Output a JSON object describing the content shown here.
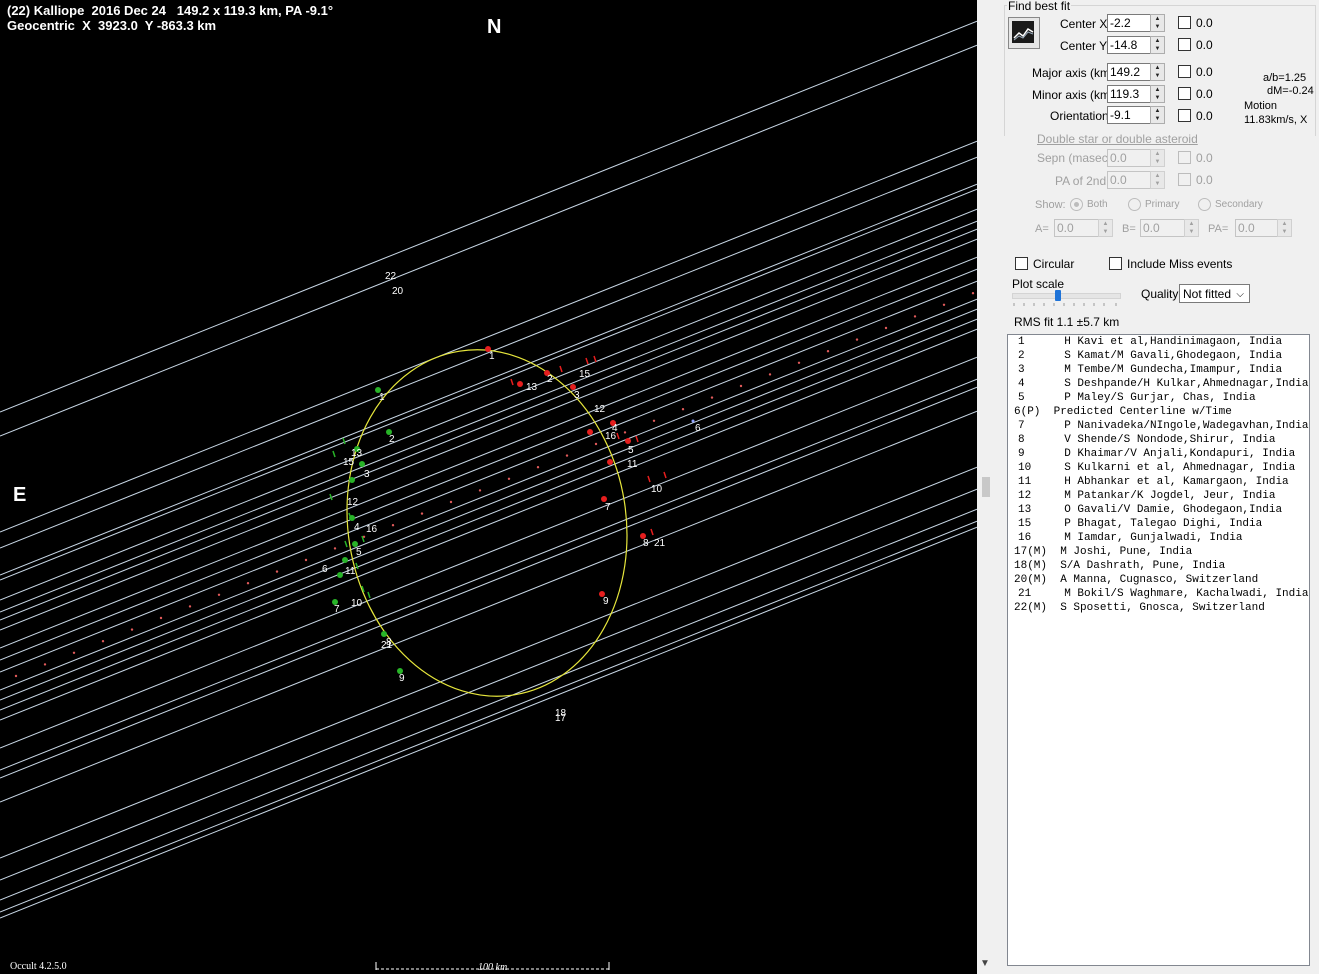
{
  "plot": {
    "title_line1": "(22) Kalliope  2016 Dec 24   149.2 x 119.3 km, PA -9.1°",
    "title_line2": "Geocentric  X  3923.0  Y -863.3 km",
    "north_label": "N",
    "east_label": "E",
    "version": "Occult 4.2.5.0",
    "scale_label": "100 km",
    "colors": {
      "background": "#000000",
      "chord": "#c8d7e6",
      "ellipse": "#e6e63c",
      "disappear": "#28b428",
      "reappear": "#e61e1e",
      "predicted": "#e05a5a"
    },
    "markers": {
      "d_labels": [
        "1",
        "2",
        "13",
        "15",
        "3",
        "12",
        "4",
        "16",
        "5",
        "6",
        "11",
        "7",
        "10",
        "8",
        "21",
        "9"
      ],
      "r_labels": [
        "1",
        "13",
        "2",
        "15",
        "3",
        "12",
        "4",
        "16",
        "5",
        "11",
        "10",
        "7",
        "8",
        "21",
        "9"
      ],
      "miss_labels": [
        "22",
        "20",
        "18",
        "17"
      ],
      "predicted_label": "6"
    }
  },
  "panel": {
    "find_best_fit": "Find best fit",
    "center_x": {
      "label": "Center X",
      "value": "-2.2",
      "delta": "0.0"
    },
    "center_y": {
      "label": "Center Y",
      "value": "-14.8",
      "delta": "0.0"
    },
    "major_axis": {
      "label": "Major axis (km)",
      "value": "149.2",
      "delta": "0.0"
    },
    "minor_axis": {
      "label": "Minor axis (km)",
      "value": "119.3",
      "delta": "0.0"
    },
    "orientation": {
      "label": "Orientation",
      "value": "-9.1",
      "delta": "0.0"
    },
    "ab_ratio": "a/b=1.25",
    "dm": "dM=-0.24",
    "motion_label": "Motion",
    "motion_value": "11.83km/s, X",
    "double_star_link": "Double star  or  double asteroid",
    "sepn": {
      "label": "Sepn (masec)",
      "value": "0.0",
      "delta": "0.0"
    },
    "pa2nd": {
      "label": "PA of 2nd",
      "value": "0.0",
      "delta": "0.0"
    },
    "show_label": "Show:",
    "show_options": [
      "Both",
      "Primary",
      "Secondary"
    ],
    "show_selected": "Both",
    "a_label": "A=",
    "a_value": "0.0",
    "b_label": "B=",
    "b_value": "0.0",
    "pa_label": "PA=",
    "pa_value": "0.0",
    "circular": "Circular",
    "include_miss": "Include Miss events",
    "plot_scale": "Plot scale",
    "quality_label": "Quality",
    "quality_value": "Not fitted",
    "rms_fit": "RMS fit  1.1 ±5.7 km",
    "observers": [
      "1      H Kavi et al,Handinimagaon, India",
      "2      S Kamat/M Gavali,Ghodegaon, India",
      "3      M Tembe/M Gundecha,Imampur, India",
      "4      S Deshpande/H Kulkar,Ahmednagar,India",
      "5      P Maley/S Gurjar, Chas, India",
      "6(P)  Predicted Centerline w/Time",
      "7      P Nanivadeka/NIngole,Wadegavhan,India",
      "8      V Shende/S Nondode,Shirur, India",
      "9      D Khaimar/V Anjali,Kondapuri, India",
      "10     S Kulkarni et al, Ahmednagar, India",
      "11     H Abhankar et al, Kamargaon, India",
      "12     M Patankar/K Jogdel, Jeur, India",
      "13     O Gavali/V Damie, Ghodegaon,India",
      "15     P Bhagat, Talegao Dighi, India",
      "16     M Iamdar, Gunjalwadi, India",
      "17(M)  M Joshi, Pune, India",
      "18(M)  S/A Dashrath, Pune, India",
      "20(M)  A Manna, Cugnasco, Switzerland",
      "21     M Bokil/S Waghmare, Kachalwadi, India",
      "22(M)  S Sposetti, Gnosca, Switzerland"
    ]
  }
}
